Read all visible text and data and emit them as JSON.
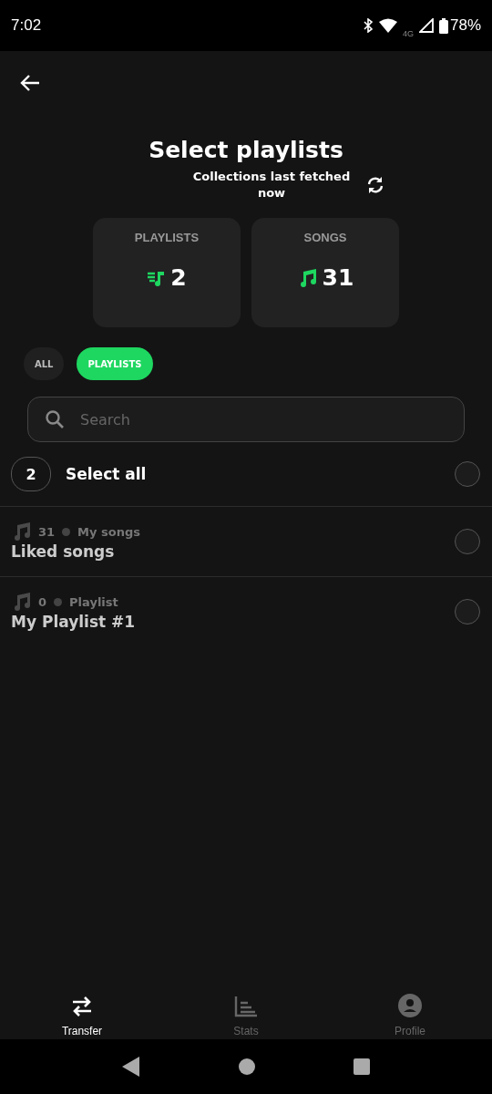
{
  "status_bar": {
    "time": "7:02",
    "network": "4G",
    "battery": "78%"
  },
  "header": {
    "title": "Select playlists",
    "subtitle": "Collections last fetched now"
  },
  "stats": [
    {
      "kind": "playlists",
      "label": "PLAYLISTS",
      "value": "2"
    },
    {
      "kind": "songs",
      "label": "SONGS",
      "value": "31"
    }
  ],
  "filters": [
    {
      "label": "ALL",
      "selected": false
    },
    {
      "label": "PLAYLISTS",
      "selected": true
    }
  ],
  "search": {
    "placeholder": "Search"
  },
  "select_all": {
    "count": "2",
    "label": "Select all",
    "checked": false
  },
  "playlists": [
    {
      "count": "31",
      "type": "My songs",
      "name": "Liked songs",
      "checked": false
    },
    {
      "count": "0",
      "type": "Playlist",
      "name": "My Playlist #1",
      "checked": false
    }
  ],
  "bottom_nav": [
    {
      "kind": "transfer",
      "label": "Transfer",
      "selected": true
    },
    {
      "kind": "stats",
      "label": "Stats",
      "selected": false
    },
    {
      "kind": "profile",
      "label": "Profile",
      "selected": false
    }
  ]
}
